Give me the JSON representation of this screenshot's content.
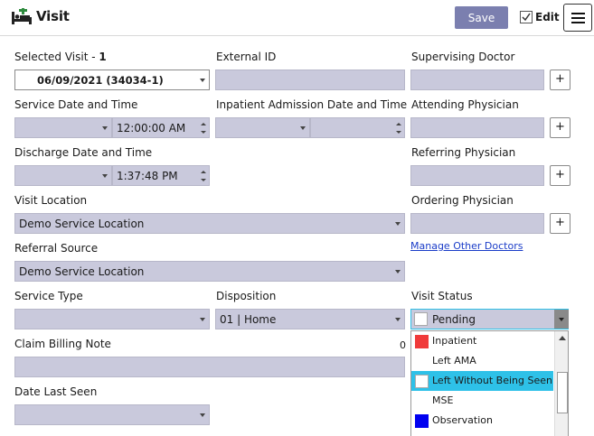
{
  "header": {
    "title": "Visit",
    "save_label": "Save",
    "edit_label": "Edit",
    "edit_checked": true
  },
  "selected_visit": {
    "label": "Selected Visit - ",
    "count": "1",
    "value": "06/09/2021 (34034-1)"
  },
  "external_id": {
    "label": "External ID",
    "value": ""
  },
  "supervising_doctor": {
    "label": "Supervising Doctor",
    "add": "+"
  },
  "service_date": {
    "label": "Service Date and Time",
    "date": "",
    "time": "12:00:00 AM"
  },
  "inpatient_admission": {
    "label": "Inpatient Admission Date and Time",
    "date": "",
    "time": ""
  },
  "attending_physician": {
    "label": "Attending Physician",
    "add": "+"
  },
  "discharge": {
    "label": "Discharge Date and Time",
    "date": "",
    "time": "1:37:48 PM"
  },
  "referring_physician": {
    "label": "Referring Physician",
    "add": "+"
  },
  "visit_location": {
    "label": "Visit Location",
    "value": "Demo Service Location"
  },
  "ordering_physician": {
    "label": "Ordering Physician",
    "add": "+"
  },
  "manage_doctors": {
    "label": "Manage Other Doctors"
  },
  "referral_source": {
    "label": "Referral Source",
    "value": "Demo Service Location"
  },
  "service_type": {
    "label": "Service Type",
    "value": ""
  },
  "disposition": {
    "label": "Disposition",
    "value": "01 | Home"
  },
  "visit_status": {
    "label": "Visit Status",
    "value": "Pending",
    "value_color": "#ffffff",
    "options": [
      {
        "label": "Inpatient",
        "color": "#f03a3a",
        "selected": false
      },
      {
        "label": "Left AMA",
        "color": "",
        "selected": false
      },
      {
        "label": "Left Without Being Seen",
        "color": "#ffffff",
        "selected": true
      },
      {
        "label": "MSE",
        "color": "",
        "selected": false
      },
      {
        "label": "Observation",
        "color": "#0000f0",
        "selected": false
      }
    ]
  },
  "claim_billing_note": {
    "label": "Claim Billing Note",
    "count": "0",
    "value": ""
  },
  "date_last_seen": {
    "label": "Date Last Seen",
    "value": ""
  },
  "colors": {
    "field_bg": "#c9c9dc",
    "save_bg": "#7b7faf",
    "selected_option": "#2ec1e8",
    "link": "#1a3cc8",
    "accent_green": "#2e8b3e"
  }
}
